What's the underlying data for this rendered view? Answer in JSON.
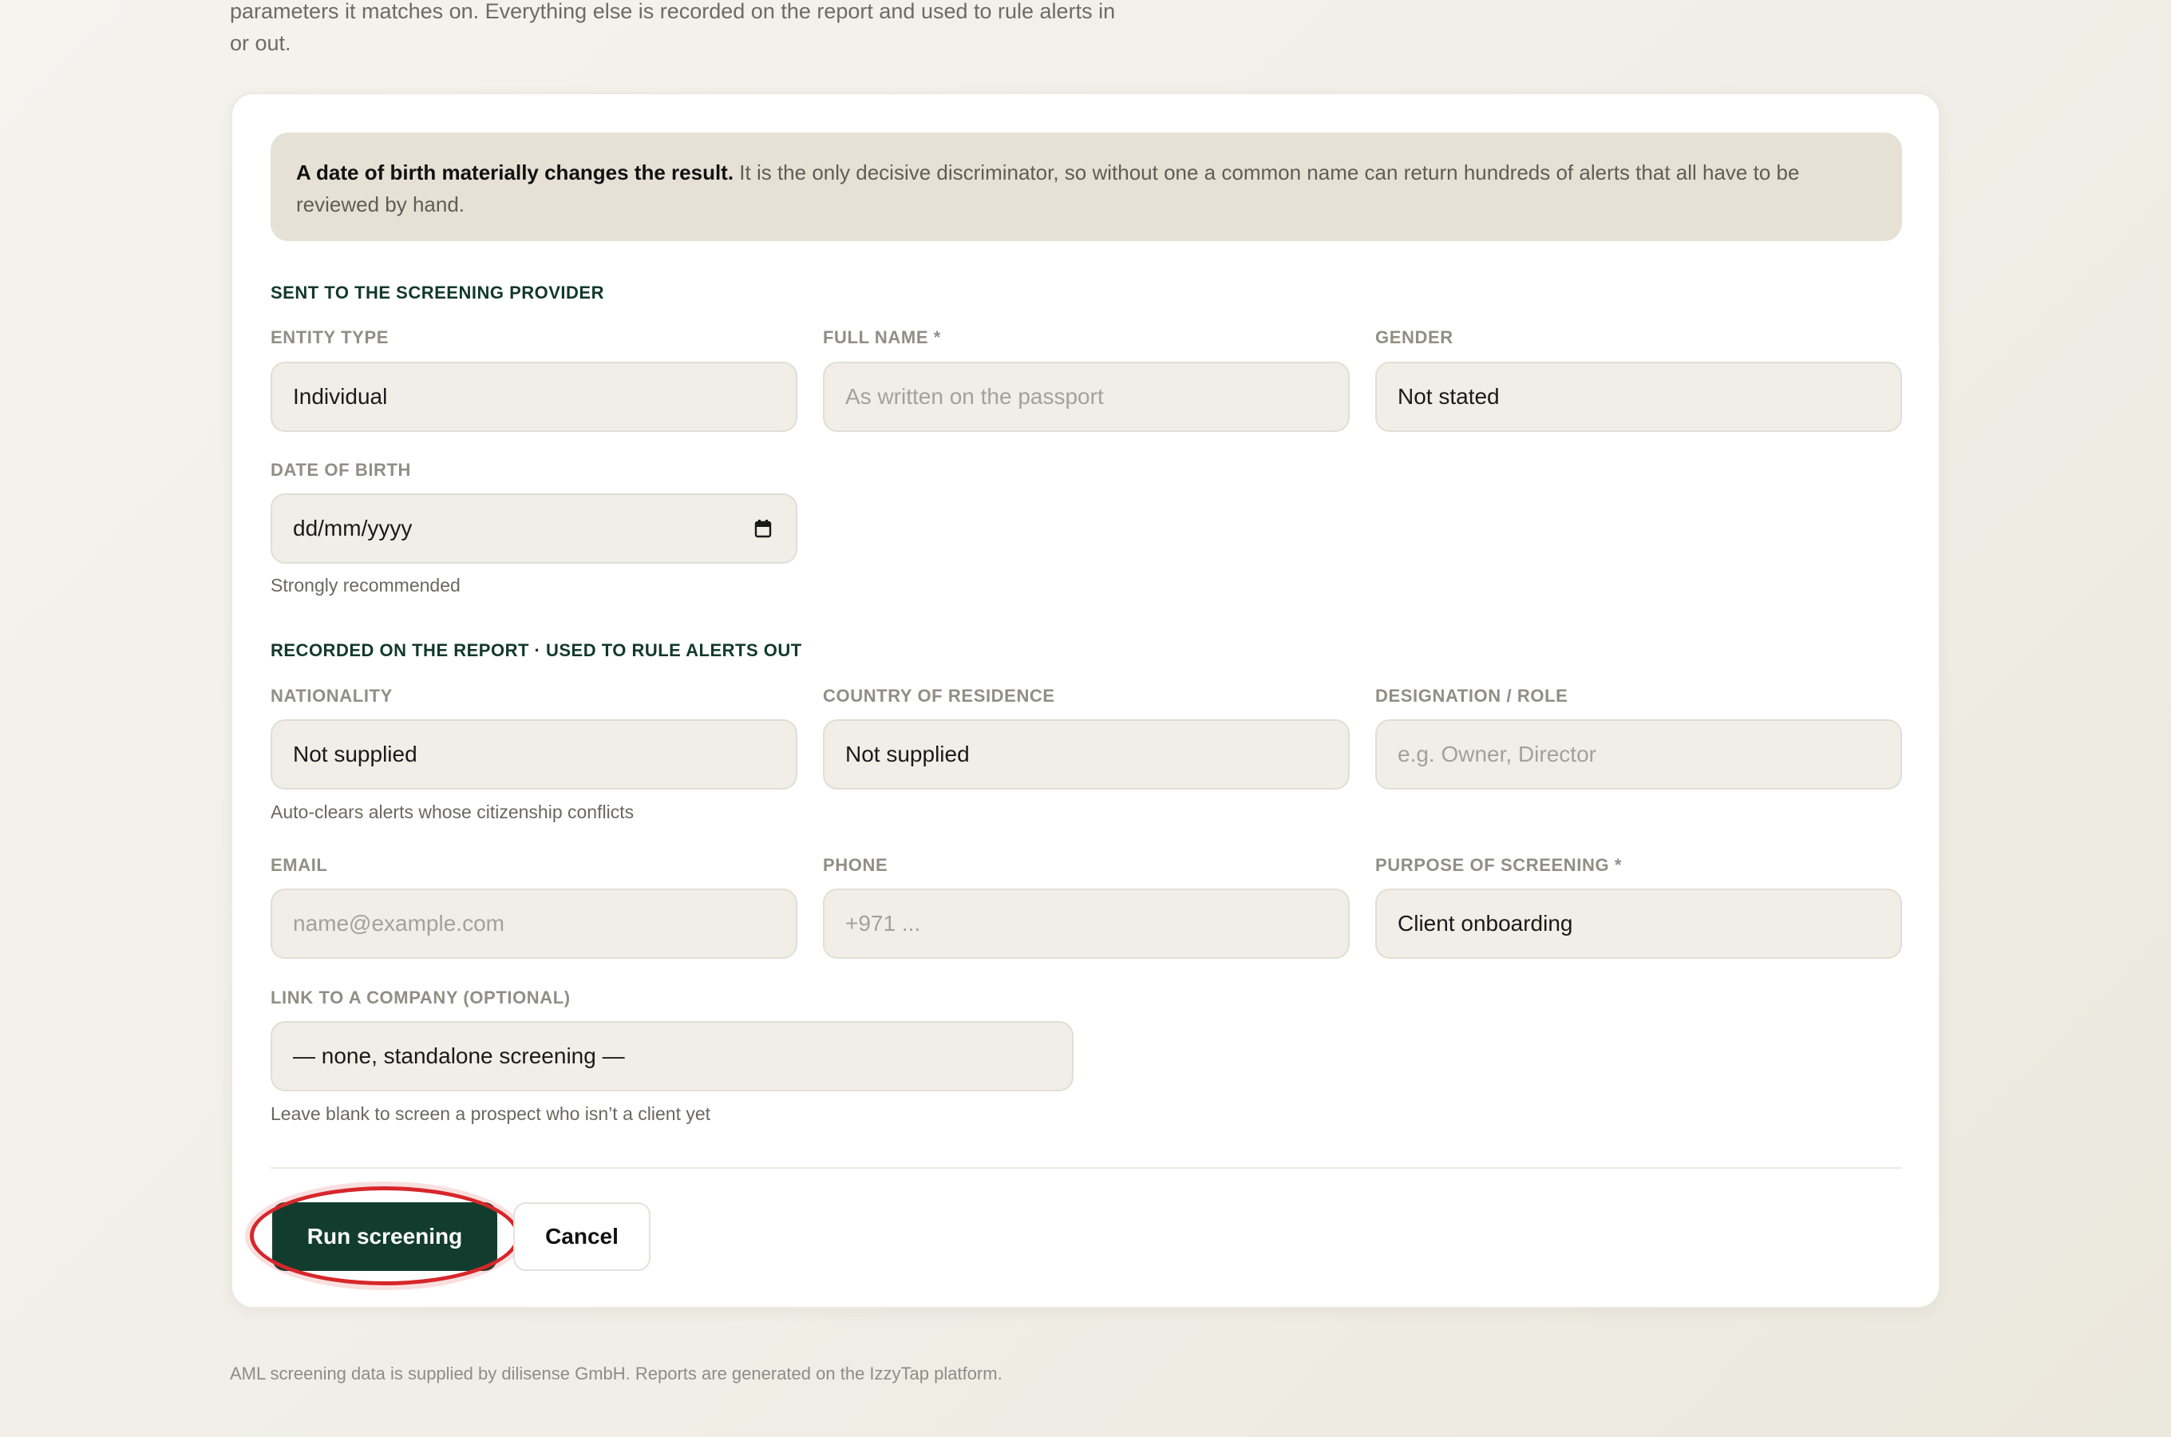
{
  "intro_text": "parameters it matches on. Everything else is recorded on the report and used to rule alerts in or out.",
  "notice": {
    "bold": "A date of birth materially changes the result.",
    "text": " It is the only decisive discriminator, so without one a common name can return hundreds of alerts that all have to be reviewed by hand."
  },
  "sections": {
    "sent": "SENT TO THE SCREENING PROVIDER",
    "recorded": "RECORDED ON THE REPORT · USED TO RULE ALERTS OUT"
  },
  "fields": {
    "entity_type": {
      "label": "ENTITY TYPE",
      "value": "Individual"
    },
    "full_name": {
      "label": "FULL NAME *",
      "placeholder": "As written on the passport"
    },
    "gender": {
      "label": "GENDER",
      "value": "Not stated"
    },
    "dob": {
      "label": "DATE OF BIRTH",
      "value": "dd/mm/yyyy",
      "hint": "Strongly recommended"
    },
    "nationality": {
      "label": "NATIONALITY",
      "value": "Not supplied",
      "hint": "Auto-clears alerts whose citizenship conflicts"
    },
    "residence": {
      "label": "COUNTRY OF RESIDENCE",
      "value": "Not supplied"
    },
    "designation": {
      "label": "DESIGNATION / ROLE",
      "placeholder": "e.g. Owner, Director"
    },
    "email": {
      "label": "EMAIL",
      "placeholder": "name@example.com"
    },
    "phone": {
      "label": "PHONE",
      "placeholder": "+971 ..."
    },
    "purpose": {
      "label": "PURPOSE OF SCREENING *",
      "value": "Client onboarding"
    },
    "company": {
      "label": "LINK TO A COMPANY (OPTIONAL)",
      "value": "— none, standalone screening —",
      "hint": "Leave blank to screen a prospect who isn’t a client yet"
    }
  },
  "buttons": {
    "run": "Run screening",
    "cancel": "Cancel"
  },
  "footer": "AML screening data is supplied by dilisense GmbH. Reports are generated on the IzzyTap platform.",
  "colors": {
    "primary": "#123d2e",
    "highlight": "#d7262a"
  }
}
